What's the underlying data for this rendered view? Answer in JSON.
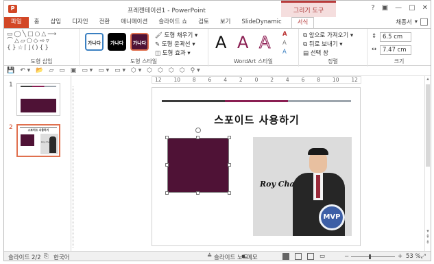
{
  "window": {
    "app_icon": "P",
    "title": "프레젠테이션1 - PowerPoint",
    "contextual_tab": "그리기 도구",
    "buttons": [
      "?",
      "▣",
      "—",
      "□",
      "✕"
    ]
  },
  "tabs": [
    {
      "label": "파일"
    },
    {
      "label": "홈"
    },
    {
      "label": "삽입"
    },
    {
      "label": "디자인"
    },
    {
      "label": "전환"
    },
    {
      "label": "애니메이션"
    },
    {
      "label": "슬라이드 쇼"
    },
    {
      "label": "검토"
    },
    {
      "label": "보기"
    },
    {
      "label": "SlideDynamic"
    },
    {
      "label": "서식"
    }
  ],
  "user": {
    "name": "채종서",
    "caret": "▾"
  },
  "ribbon": {
    "insert_shapes": {
      "label": "도형 삽입",
      "glyphs": "▭◯╲□○△⟶\n⌒△▱⬠◇⇨▿\n{}☆⌈⌋(){}"
    },
    "shape_styles": {
      "label": "도형 스타일",
      "presets": [
        {
          "text": "가나다",
          "bg": "#ffffff",
          "fg": "#333333",
          "border": "#3a7fc1"
        },
        {
          "text": "가나다",
          "bg": "#000000",
          "fg": "#ffffff",
          "border": "#000000"
        },
        {
          "text": "가나다",
          "bg": "#4f1236",
          "fg": "#ffffff",
          "border": "#e0704e"
        }
      ],
      "fill": "도형 채우기 ▾",
      "outline": "도형 윤곽선 ▾",
      "effects": "도형 효과 ▾"
    },
    "wordart": {
      "label": "WordArt 스타일",
      "letters": [
        "A",
        "A",
        "A"
      ]
    },
    "arrange": {
      "label": "정렬",
      "forward": "앞으로 가져오기 ▾",
      "backward": "뒤로 보내기 ▾",
      "selection_pane": "선택 창"
    },
    "size": {
      "label": "크기",
      "height": "6.5 cm",
      "width": "7.47 cm"
    }
  },
  "qat": {
    "icons": [
      "💾",
      "↶ ▾",
      "📂",
      "▱",
      "▭",
      "▣",
      "▭ ▾",
      "▭ ▾",
      "▭ ▾",
      "⬡ ▾",
      "⬡",
      "⬡",
      "⬡",
      "⬡",
      "⚲ ▾"
    ]
  },
  "ruler": {
    "ticks": [
      "12",
      "10",
      "8",
      "6",
      "4",
      "2",
      "0",
      "2",
      "4",
      "6",
      "8",
      "10",
      "12"
    ]
  },
  "thumbnails": [
    {
      "number": "1"
    },
    {
      "number": "2",
      "title": "스포이드 사용하기",
      "name": "Roy Chae"
    }
  ],
  "slide": {
    "bars": [
      "#3b3b3b",
      "#8a1e52",
      "#9da5ad"
    ],
    "title": "스포이드 사용하기",
    "shape_fill": "#4f1236",
    "photo_caption": "Roy Chae",
    "badge": "MVP"
  },
  "scrollbar": {
    "up": "▴",
    "down": "▾",
    "prev": "⇞",
    "next": "⇟"
  },
  "status": {
    "slide_count": "슬라이드 2/2",
    "language": "한국어",
    "notes": "슬라이드 노트",
    "comments": "메모",
    "zoom": "53 %",
    "zoom_level": 0.53
  }
}
